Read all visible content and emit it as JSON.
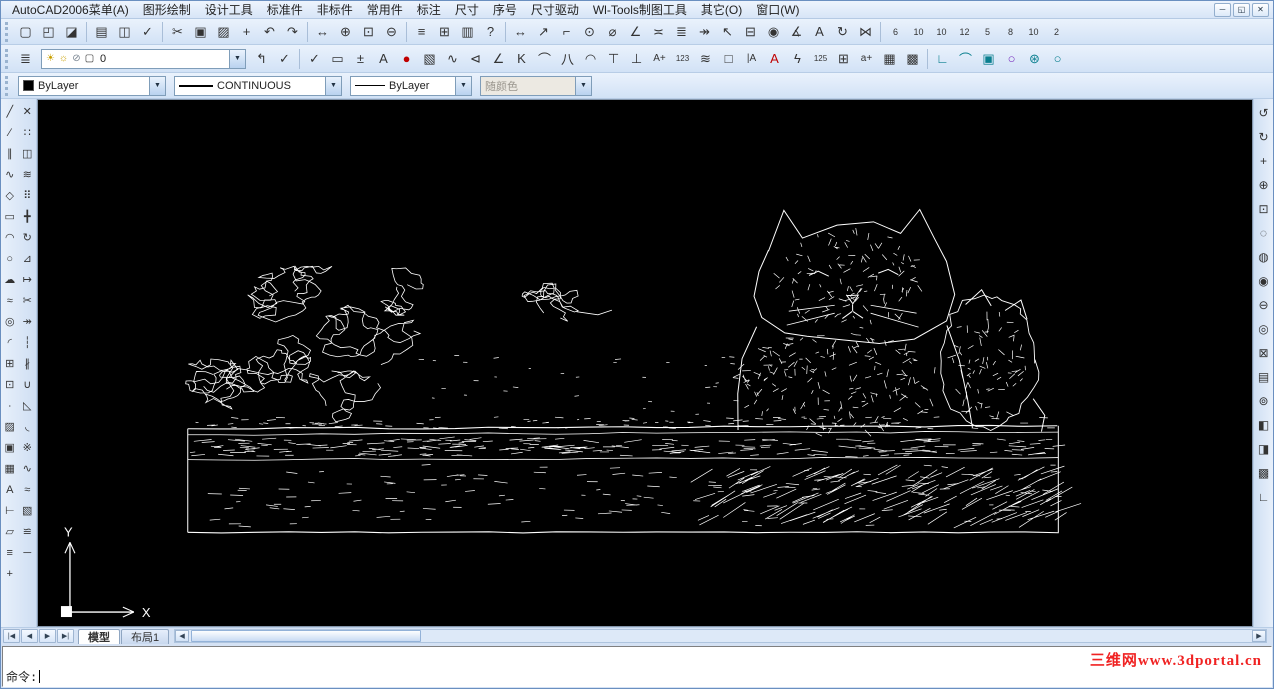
{
  "ui": {
    "dropdown_arrow": "▼",
    "scroll_left": "◀",
    "scroll_right": "▶"
  },
  "colors": {
    "canvas_bg": "#000000",
    "toolbar_bg": "#d6e4f6",
    "border_accent": "#7f9db9",
    "watermark_red": "#f02222"
  },
  "menu_bar": {
    "items": [
      {
        "n": "menu-autocad2006",
        "g": "AutoCAD2006菜单(A)"
      },
      {
        "n": "menu-graphic-draw",
        "g": "图形绘制"
      },
      {
        "n": "menu-design-tools",
        "g": "设计工具"
      },
      {
        "n": "menu-standard-parts",
        "g": "标准件"
      },
      {
        "n": "menu-nonstandard-parts",
        "g": "非标件"
      },
      {
        "n": "menu-common-parts",
        "g": "常用件"
      },
      {
        "n": "menu-annotate",
        "g": "标注"
      },
      {
        "n": "menu-dimension",
        "g": "尺寸"
      },
      {
        "n": "menu-serial-number",
        "g": "序号"
      },
      {
        "n": "menu-dimension-drive",
        "g": "尺寸驱动"
      },
      {
        "n": "menu-wltools",
        "g": "Wl-Tools制图工具"
      },
      {
        "n": "menu-other",
        "g": "其它(O)"
      },
      {
        "n": "menu-window",
        "g": "窗口(W)"
      }
    ],
    "window_controls": [
      {
        "n": "minimize-button",
        "g": "─"
      },
      {
        "n": "restore-button",
        "g": "◱"
      },
      {
        "n": "close-button",
        "g": "✕"
      }
    ]
  },
  "toolbar_standard": {
    "icons": [
      {
        "n": "new-file-icon",
        "g": "▢"
      },
      {
        "n": "open-file-icon",
        "g": "◰"
      },
      {
        "n": "save-file-icon",
        "g": "◪"
      },
      {
        "sep": true
      },
      {
        "n": "plot-icon",
        "g": "▤"
      },
      {
        "n": "print-preview-icon",
        "g": "◫"
      },
      {
        "n": "spell-check-icon",
        "g": "✓"
      },
      {
        "sep": true
      },
      {
        "n": "cut-icon",
        "g": "✂"
      },
      {
        "n": "copy-icon",
        "g": "▣"
      },
      {
        "n": "paste-icon",
        "g": "▨"
      },
      {
        "n": "match-properties-icon",
        "g": "+"
      },
      {
        "n": "undo-icon",
        "g": "↶"
      },
      {
        "n": "redo-icon",
        "g": "↷"
      },
      {
        "sep": true
      },
      {
        "n": "pan-icon",
        "g": "↔"
      },
      {
        "n": "zoom-realtime-icon",
        "g": "⊕"
      },
      {
        "n": "zoom-window-icon",
        "g": "⊡"
      },
      {
        "n": "zoom-previous-icon",
        "g": "⊖"
      },
      {
        "sep": true
      },
      {
        "n": "properties-icon",
        "g": "≡"
      },
      {
        "n": "design-center-icon",
        "g": "⊞"
      },
      {
        "n": "tool-palettes-icon",
        "g": "▥"
      },
      {
        "n": "help-icon",
        "g": "?"
      },
      {
        "sep": true
      },
      {
        "n": "linear-dimension-icon",
        "g": "↔"
      },
      {
        "n": "aligned-dimension-icon",
        "g": "↗"
      },
      {
        "n": "ordinate-dimension-icon",
        "g": "⌐"
      },
      {
        "n": "radius-dimension-icon",
        "g": "⊙"
      },
      {
        "n": "diameter-dimension-icon",
        "g": "⌀"
      },
      {
        "n": "angular-dimension-icon",
        "g": "∠"
      },
      {
        "n": "quick-dimension-icon",
        "g": "≍"
      },
      {
        "n": "baseline-dimension-icon",
        "g": "≣"
      },
      {
        "n": "continue-dimension-icon",
        "g": "↠"
      },
      {
        "n": "quick-leader-icon",
        "g": "↖"
      },
      {
        "n": "tolerance-icon",
        "g": "⊟"
      },
      {
        "n": "center-mark-icon",
        "g": "◉"
      },
      {
        "n": "dimension-edit-icon",
        "g": "∡"
      },
      {
        "n": "dimension-text-edit-icon",
        "g": "A"
      },
      {
        "n": "dimension-update-icon",
        "g": "↻"
      },
      {
        "n": "dimension-style-icon",
        "g": "⋈"
      },
      {
        "sep": true
      },
      {
        "n": "preset-scale-button-1",
        "g": "6",
        "s": 9
      },
      {
        "n": "preset-scale-button-2",
        "g": "10",
        "s": 9
      },
      {
        "n": "preset-scale-button-3",
        "g": "10",
        "s": 9
      },
      {
        "n": "preset-scale-button-4",
        "g": "12",
        "s": 9
      },
      {
        "n": "preset-scale-button-5",
        "g": "5",
        "s": 9
      },
      {
        "n": "preset-scale-button-6",
        "g": "8",
        "s": 9
      },
      {
        "n": "preset-scale-button-7",
        "g": "10",
        "s": 9
      },
      {
        "n": "preset-scale-button-8",
        "g": "2",
        "s": 9
      }
    ]
  },
  "toolbar_layers": {
    "icons_left": [
      {
        "n": "layer-manager-icon",
        "g": "≣"
      }
    ],
    "layer_combo": {
      "value": "0",
      "state_icons": [
        {
          "n": "layer-on-bulb-icon",
          "g": "☀",
          "c": "#c9a002"
        },
        {
          "n": "layer-freeze-sun-icon",
          "g": "☼",
          "c": "#c9a002"
        },
        {
          "n": "layer-lock-icon",
          "g": "⊘",
          "c": "#76828f"
        },
        {
          "n": "layer-color-swatch-icon",
          "g": "▢",
          "c": "#333333"
        }
      ]
    },
    "icons_mid": [
      {
        "n": "layer-previous-icon",
        "g": "↰"
      },
      {
        "n": "make-layer-current-icon",
        "g": "✓"
      },
      {
        "sep": true
      }
    ],
    "icons": [
      {
        "n": "draft-check-icon",
        "g": "✓"
      },
      {
        "n": "rectangle-symbol-icon",
        "g": "▭"
      },
      {
        "n": "plus-minus-tolerance-icon",
        "g": "±"
      },
      {
        "n": "text-edit-icon",
        "g": "A"
      },
      {
        "n": "red-dot-icon",
        "g": "●",
        "c": "#c00000"
      },
      {
        "n": "hatch-symbol-icon",
        "g": "▧"
      },
      {
        "n": "wave-symbol-icon",
        "g": "∿"
      },
      {
        "n": "taper-symbol-icon",
        "g": "⊲"
      },
      {
        "n": "angle-symbol-icon",
        "g": "∠"
      },
      {
        "n": "k-factor-icon",
        "g": "K"
      },
      {
        "n": "arc-length-icon",
        "g": "⌒"
      },
      {
        "n": "chamfer-symbol-icon",
        "g": "八"
      },
      {
        "n": "arc-segment-icon",
        "g": "◠"
      },
      {
        "n": "datum-target-icon",
        "g": "⊤"
      },
      {
        "n": "perpendicular-symbol-icon",
        "g": "⊥"
      },
      {
        "n": "text-height-icon",
        "g": "A+",
        "s": 10
      },
      {
        "n": "number-123-icon",
        "g": "123",
        "s": 8
      },
      {
        "n": "zigzag-icon",
        "g": "≋"
      },
      {
        "n": "box-symbol-icon",
        "g": "□"
      },
      {
        "n": "ia-text-icon",
        "g": "|A",
        "s": 10
      },
      {
        "n": "red-text-icon",
        "g": "A",
        "c": "#c00000"
      },
      {
        "n": "lightning-icon",
        "g": "ϟ"
      },
      {
        "n": "scale-125-icon",
        "g": "125",
        "s": 8
      },
      {
        "n": "grid-table-icon",
        "g": "⊞"
      },
      {
        "n": "lowercase-a-icon",
        "g": "a+",
        "s": 10
      },
      {
        "n": "table-symbol-icon",
        "g": "▦"
      },
      {
        "n": "diagonal-table-icon",
        "g": "▩"
      },
      {
        "sep": true
      },
      {
        "n": "corner-line-icon",
        "g": "∟",
        "c": "#0a7f8f"
      },
      {
        "n": "arc-teal-icon",
        "g": "⌒",
        "c": "#0a7f8f"
      },
      {
        "n": "solid-square-icon",
        "g": "▣",
        "c": "#0a7f8f"
      },
      {
        "n": "purple-ring-icon",
        "g": "○",
        "c": "#7a2fbf"
      },
      {
        "n": "flower-icon",
        "g": "⊛",
        "c": "#0a7f8f"
      },
      {
        "n": "teal-ring-icon",
        "g": "○",
        "c": "#0a7f8f"
      }
    ]
  },
  "properties_bar": {
    "color_value": "ByLayer",
    "color_swatch_hex": "#000000",
    "linetype_value": "CONTINUOUS",
    "lineweight_value": "ByLayer",
    "plotstyle_value": "随颜色"
  },
  "draw_toolbar": {
    "icons": [
      {
        "n": "line-icon",
        "g": "╱"
      },
      {
        "n": "construction-line-icon",
        "g": "∕"
      },
      {
        "n": "multiline-icon",
        "g": "∥"
      },
      {
        "n": "polyline-icon",
        "g": "∿"
      },
      {
        "n": "polygon-icon",
        "g": "◇"
      },
      {
        "n": "rectangle-icon",
        "g": "▭"
      },
      {
        "n": "arc-icon",
        "g": "◠"
      },
      {
        "n": "circle-icon",
        "g": "○"
      },
      {
        "n": "revcloud-icon",
        "g": "☁"
      },
      {
        "n": "spline-icon",
        "g": "≈"
      },
      {
        "n": "ellipse-icon",
        "g": "◎"
      },
      {
        "n": "ellipse-arc-icon",
        "g": "◜"
      },
      {
        "n": "insert-block-icon",
        "g": "⊞"
      },
      {
        "n": "make-block-icon",
        "g": "⊡"
      },
      {
        "n": "point-icon",
        "g": "∙"
      },
      {
        "n": "hatch-icon",
        "g": "▨"
      },
      {
        "n": "region-icon",
        "g": "▣"
      },
      {
        "n": "table-icon",
        "g": "▦"
      },
      {
        "n": "mtext-icon",
        "g": "A"
      },
      {
        "n": "distance-icon",
        "g": "⊢"
      },
      {
        "n": "area-icon",
        "g": "▱"
      },
      {
        "n": "list-icon",
        "g": "≡"
      },
      {
        "n": "id-point-icon",
        "g": "+"
      }
    ]
  },
  "modify_toolbar": {
    "icons": [
      {
        "n": "erase-icon",
        "g": "✕"
      },
      {
        "n": "copy-object-icon",
        "g": "∷"
      },
      {
        "n": "mirror-icon",
        "g": "◫"
      },
      {
        "n": "offset-icon",
        "g": "≋"
      },
      {
        "n": "array-icon",
        "g": "⠿"
      },
      {
        "n": "move-icon",
        "g": "╋"
      },
      {
        "n": "rotate-icon",
        "g": "↻"
      },
      {
        "n": "scale-icon",
        "g": "⊿"
      },
      {
        "n": "stretch-icon",
        "g": "↦"
      },
      {
        "n": "trim-icon",
        "g": "✂"
      },
      {
        "n": "extend-icon",
        "g": "↠"
      },
      {
        "n": "break-at-point-icon",
        "g": "┆"
      },
      {
        "n": "break-icon",
        "g": "∦"
      },
      {
        "n": "join-icon",
        "g": "∪"
      },
      {
        "n": "chamfer-icon",
        "g": "◺"
      },
      {
        "n": "fillet-icon",
        "g": "◟"
      },
      {
        "n": "explode-icon",
        "g": "※"
      },
      {
        "n": "edit-polyline-icon",
        "g": "∿"
      },
      {
        "n": "edit-spline-icon",
        "g": "≈"
      },
      {
        "n": "edit-hatch-icon",
        "g": "▧"
      },
      {
        "n": "align-icon",
        "g": "≌"
      },
      {
        "n": "lengthen-icon",
        "g": "─"
      }
    ]
  },
  "right_toolbar": {
    "icons": [
      {
        "n": "redraw-icon",
        "g": "↺"
      },
      {
        "n": "regen-icon",
        "g": "↻"
      },
      {
        "n": "pan-realtime-icon",
        "g": "+"
      },
      {
        "n": "zoom-realtime-icon",
        "g": "⊕"
      },
      {
        "n": "zoom-window-icon",
        "g": "⊡"
      },
      {
        "n": "zoom-dynamic-icon",
        "g": "◌"
      },
      {
        "n": "zoom-scale-icon",
        "g": "◍"
      },
      {
        "n": "zoom-center-icon",
        "g": "◉"
      },
      {
        "n": "zoom-out-icon",
        "g": "⊖"
      },
      {
        "n": "zoom-all-icon",
        "g": "◎"
      },
      {
        "n": "zoom-extents-icon",
        "g": "⊠"
      },
      {
        "n": "named-views-icon",
        "g": "▤"
      },
      {
        "n": "orbit-icon",
        "g": "⊚"
      },
      {
        "n": "hide-icon",
        "g": "◧"
      },
      {
        "n": "shade-icon",
        "g": "◨"
      },
      {
        "n": "render-icon",
        "g": "▩"
      },
      {
        "n": "ucs-icon",
        "g": "∟"
      }
    ]
  },
  "canvas": {
    "description": "Black model-space viewport showing a white edge-traced line drawing: a kitten with pointed ears peeking over a long horizontal ledge wall, scribbled foliage bushes on the left, scattered specks, and a UCS axis icon at lower left",
    "ucs": {
      "x": "X",
      "y": "Y"
    }
  },
  "tab_bar": {
    "nav": [
      {
        "n": "first-tab-button",
        "g": "|◀"
      },
      {
        "n": "prev-tab-button",
        "g": "◀"
      },
      {
        "n": "next-tab-button",
        "g": "▶"
      },
      {
        "n": "last-tab-button",
        "g": "▶|"
      }
    ],
    "tabs": [
      {
        "n": "tab-model",
        "label": "模型",
        "active": true
      },
      {
        "n": "tab-layout1",
        "label": "布局1"
      }
    ]
  },
  "command_window": {
    "prompt": "命令:"
  },
  "watermark": {
    "text": "三维网www.3dportal.cn",
    "color": "#f02222"
  }
}
